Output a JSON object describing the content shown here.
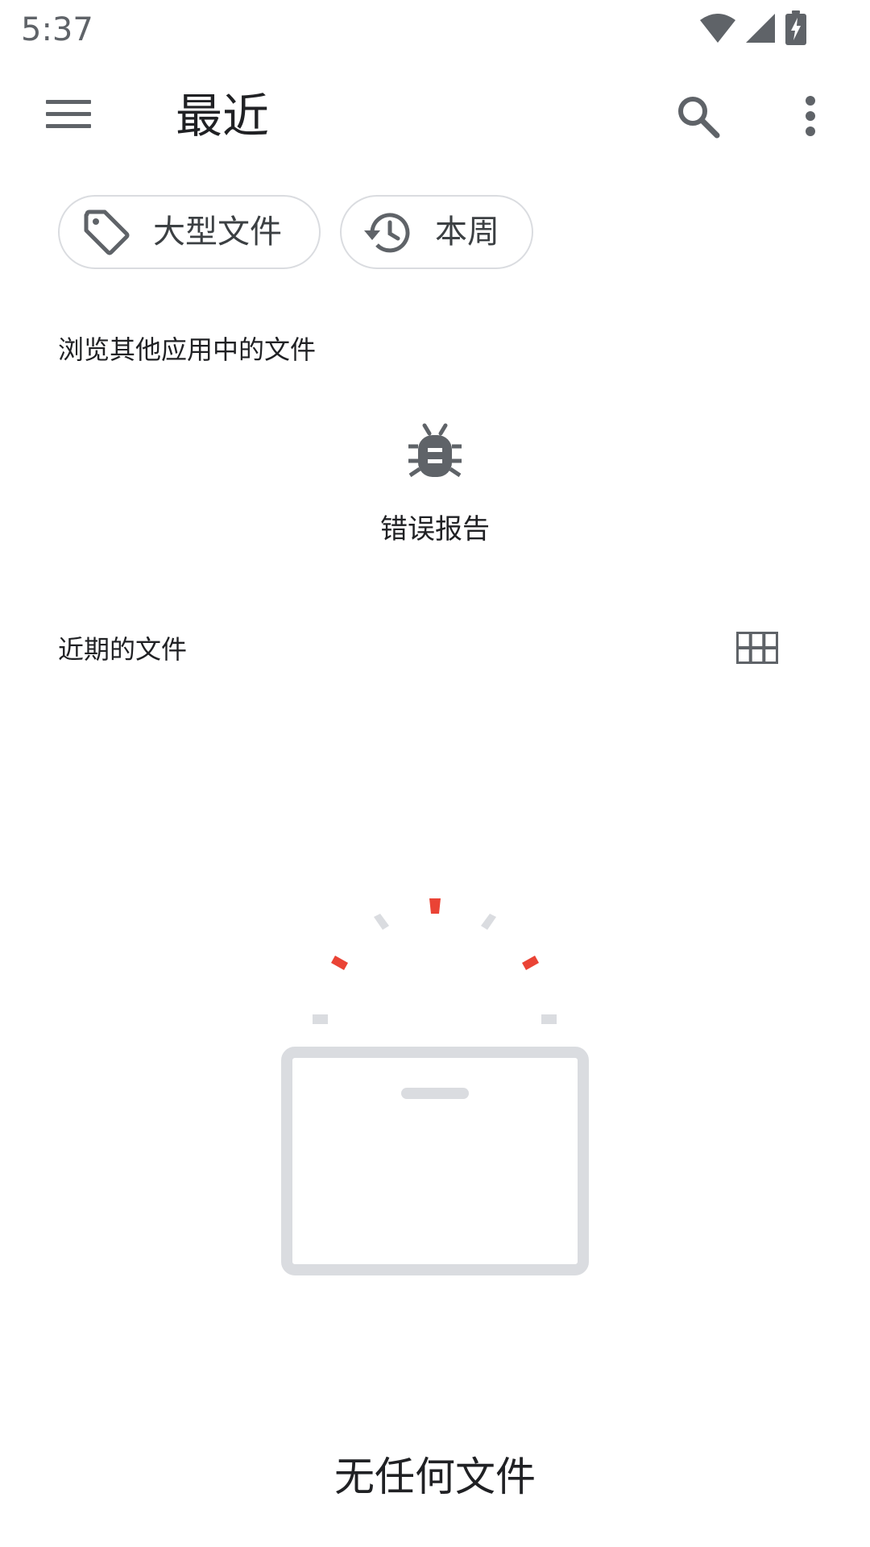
{
  "status_bar": {
    "time": "5:37",
    "icons": [
      "wifi-icon",
      "signal-icon",
      "battery-charging-icon"
    ]
  },
  "app_bar": {
    "title": "最近",
    "icons": [
      "menu-icon",
      "search-icon",
      "more-vert-icon"
    ]
  },
  "chips": [
    {
      "label": "大型文件",
      "icon": "tag-icon"
    },
    {
      "label": "本周",
      "icon": "history-icon"
    }
  ],
  "browse_section": {
    "header": "浏览其他应用中的文件",
    "apps": [
      {
        "label": "错误报告",
        "icon": "bug-report-icon"
      }
    ]
  },
  "recent_section": {
    "header": "近期的文件",
    "view_toggle_icon": "grid-view-icon"
  },
  "empty_state": {
    "text": "无任何文件"
  },
  "colors": {
    "icon_gray": "#5f6368",
    "chip_border": "#dadce0",
    "accent_red": "#ea4335",
    "illustration_gray": "#dadce0"
  }
}
